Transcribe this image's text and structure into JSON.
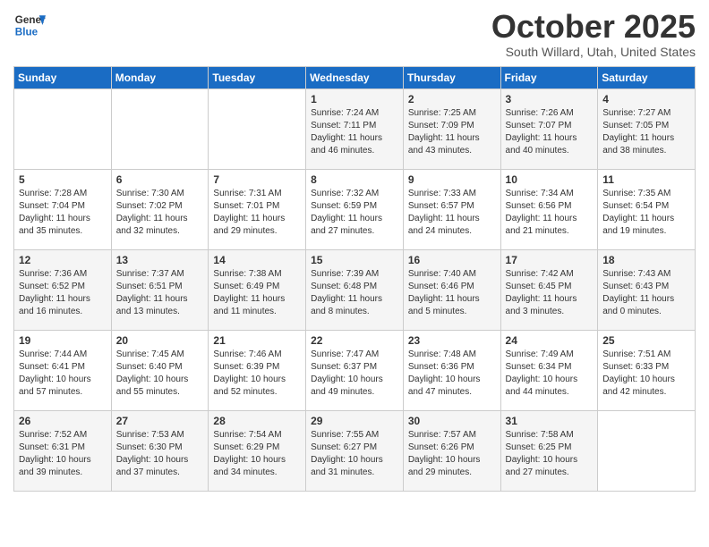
{
  "header": {
    "logo_line1": "General",
    "logo_line2": "Blue",
    "month_title": "October 2025",
    "location": "South Willard, Utah, United States"
  },
  "days_of_week": [
    "Sunday",
    "Monday",
    "Tuesday",
    "Wednesday",
    "Thursday",
    "Friday",
    "Saturday"
  ],
  "weeks": [
    [
      {
        "day": "",
        "content": ""
      },
      {
        "day": "",
        "content": ""
      },
      {
        "day": "",
        "content": ""
      },
      {
        "day": "1",
        "content": "Sunrise: 7:24 AM\nSunset: 7:11 PM\nDaylight: 11 hours and 46 minutes."
      },
      {
        "day": "2",
        "content": "Sunrise: 7:25 AM\nSunset: 7:09 PM\nDaylight: 11 hours and 43 minutes."
      },
      {
        "day": "3",
        "content": "Sunrise: 7:26 AM\nSunset: 7:07 PM\nDaylight: 11 hours and 40 minutes."
      },
      {
        "day": "4",
        "content": "Sunrise: 7:27 AM\nSunset: 7:05 PM\nDaylight: 11 hours and 38 minutes."
      }
    ],
    [
      {
        "day": "5",
        "content": "Sunrise: 7:28 AM\nSunset: 7:04 PM\nDaylight: 11 hours and 35 minutes."
      },
      {
        "day": "6",
        "content": "Sunrise: 7:30 AM\nSunset: 7:02 PM\nDaylight: 11 hours and 32 minutes."
      },
      {
        "day": "7",
        "content": "Sunrise: 7:31 AM\nSunset: 7:01 PM\nDaylight: 11 hours and 29 minutes."
      },
      {
        "day": "8",
        "content": "Sunrise: 7:32 AM\nSunset: 6:59 PM\nDaylight: 11 hours and 27 minutes."
      },
      {
        "day": "9",
        "content": "Sunrise: 7:33 AM\nSunset: 6:57 PM\nDaylight: 11 hours and 24 minutes."
      },
      {
        "day": "10",
        "content": "Sunrise: 7:34 AM\nSunset: 6:56 PM\nDaylight: 11 hours and 21 minutes."
      },
      {
        "day": "11",
        "content": "Sunrise: 7:35 AM\nSunset: 6:54 PM\nDaylight: 11 hours and 19 minutes."
      }
    ],
    [
      {
        "day": "12",
        "content": "Sunrise: 7:36 AM\nSunset: 6:52 PM\nDaylight: 11 hours and 16 minutes."
      },
      {
        "day": "13",
        "content": "Sunrise: 7:37 AM\nSunset: 6:51 PM\nDaylight: 11 hours and 13 minutes."
      },
      {
        "day": "14",
        "content": "Sunrise: 7:38 AM\nSunset: 6:49 PM\nDaylight: 11 hours and 11 minutes."
      },
      {
        "day": "15",
        "content": "Sunrise: 7:39 AM\nSunset: 6:48 PM\nDaylight: 11 hours and 8 minutes."
      },
      {
        "day": "16",
        "content": "Sunrise: 7:40 AM\nSunset: 6:46 PM\nDaylight: 11 hours and 5 minutes."
      },
      {
        "day": "17",
        "content": "Sunrise: 7:42 AM\nSunset: 6:45 PM\nDaylight: 11 hours and 3 minutes."
      },
      {
        "day": "18",
        "content": "Sunrise: 7:43 AM\nSunset: 6:43 PM\nDaylight: 11 hours and 0 minutes."
      }
    ],
    [
      {
        "day": "19",
        "content": "Sunrise: 7:44 AM\nSunset: 6:41 PM\nDaylight: 10 hours and 57 minutes."
      },
      {
        "day": "20",
        "content": "Sunrise: 7:45 AM\nSunset: 6:40 PM\nDaylight: 10 hours and 55 minutes."
      },
      {
        "day": "21",
        "content": "Sunrise: 7:46 AM\nSunset: 6:39 PM\nDaylight: 10 hours and 52 minutes."
      },
      {
        "day": "22",
        "content": "Sunrise: 7:47 AM\nSunset: 6:37 PM\nDaylight: 10 hours and 49 minutes."
      },
      {
        "day": "23",
        "content": "Sunrise: 7:48 AM\nSunset: 6:36 PM\nDaylight: 10 hours and 47 minutes."
      },
      {
        "day": "24",
        "content": "Sunrise: 7:49 AM\nSunset: 6:34 PM\nDaylight: 10 hours and 44 minutes."
      },
      {
        "day": "25",
        "content": "Sunrise: 7:51 AM\nSunset: 6:33 PM\nDaylight: 10 hours and 42 minutes."
      }
    ],
    [
      {
        "day": "26",
        "content": "Sunrise: 7:52 AM\nSunset: 6:31 PM\nDaylight: 10 hours and 39 minutes."
      },
      {
        "day": "27",
        "content": "Sunrise: 7:53 AM\nSunset: 6:30 PM\nDaylight: 10 hours and 37 minutes."
      },
      {
        "day": "28",
        "content": "Sunrise: 7:54 AM\nSunset: 6:29 PM\nDaylight: 10 hours and 34 minutes."
      },
      {
        "day": "29",
        "content": "Sunrise: 7:55 AM\nSunset: 6:27 PM\nDaylight: 10 hours and 31 minutes."
      },
      {
        "day": "30",
        "content": "Sunrise: 7:57 AM\nSunset: 6:26 PM\nDaylight: 10 hours and 29 minutes."
      },
      {
        "day": "31",
        "content": "Sunrise: 7:58 AM\nSunset: 6:25 PM\nDaylight: 10 hours and 27 minutes."
      },
      {
        "day": "",
        "content": ""
      }
    ]
  ]
}
